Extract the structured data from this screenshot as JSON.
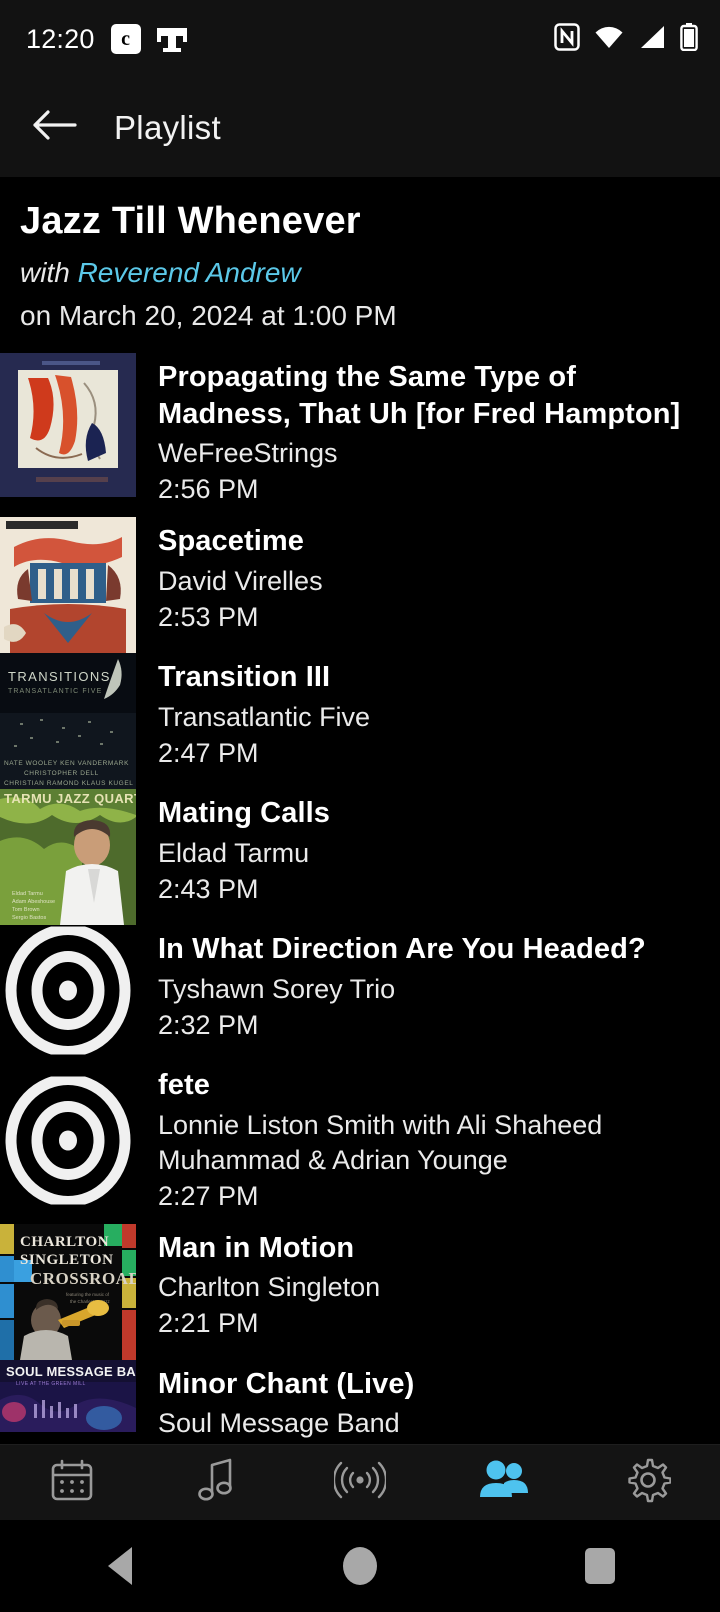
{
  "status_bar": {
    "time": "12:20",
    "carrier_badge": "c",
    "carrier_logo_name": "t-mobile-logo",
    "icons": [
      "nfc-icon",
      "wifi-icon",
      "cellular-signal-icon",
      "battery-icon"
    ]
  },
  "app_bar": {
    "back_label": "←",
    "title": "Playlist"
  },
  "show": {
    "title": "Jazz Till Whenever",
    "with_label": "with ",
    "host": "Reverend Andrew",
    "when": "on March 20, 2024 at 1:00 PM",
    "host_color": "#5bc8e8"
  },
  "tracks": [
    {
      "title": "Propagating the Same Type of Madness, That Uh [for Fred Hampton]",
      "artist": "WeFreeStrings",
      "time": "2:56 PM",
      "art": "album-art-wefreestrings"
    },
    {
      "title": "Spacetime",
      "artist": "David Virelles",
      "time": "2:53 PM",
      "art": "album-art-david-virelles"
    },
    {
      "title": "Transition III",
      "artist": "Transatlantic Five",
      "time": "2:47 PM",
      "art": "album-art-transitions"
    },
    {
      "title": "Mating Calls",
      "artist": "Eldad Tarmu",
      "time": "2:43 PM",
      "art": "album-art-tarmu-jazz-quartet"
    },
    {
      "title": "In What Direction Are You Headed?",
      "artist": "Tyshawn Sorey Trio",
      "time": "2:32 PM",
      "art": "placeholder-vinyl-icon"
    },
    {
      "title": "fete",
      "artist": "Lonnie Liston Smith with Ali Shaheed Muhammad & Adrian Younge",
      "time": "2:27 PM",
      "art": "placeholder-vinyl-icon"
    },
    {
      "title": "Man in Motion",
      "artist": "Charlton Singleton",
      "time": "2:21 PM",
      "art": "album-art-charlton-singleton-crossroads"
    },
    {
      "title": "Minor Chant (Live)",
      "artist": "Soul Message Band",
      "time": "",
      "art": "album-art-soul-message-band"
    }
  ],
  "bottom_nav": {
    "active_color": "#4ec3ef",
    "inactive_color": "#9a9a9a",
    "items": [
      {
        "name": "calendar-icon",
        "label": "Schedule",
        "active": false
      },
      {
        "name": "music-note-icon",
        "label": "Music",
        "active": false
      },
      {
        "name": "broadcast-icon",
        "label": "Live",
        "active": false
      },
      {
        "name": "people-icon",
        "label": "Hosts",
        "active": true
      },
      {
        "name": "gear-icon",
        "label": "Settings",
        "active": false
      }
    ]
  },
  "system_nav": {
    "back": "back-triangle",
    "home": "home-circle",
    "recents": "recents-square"
  }
}
